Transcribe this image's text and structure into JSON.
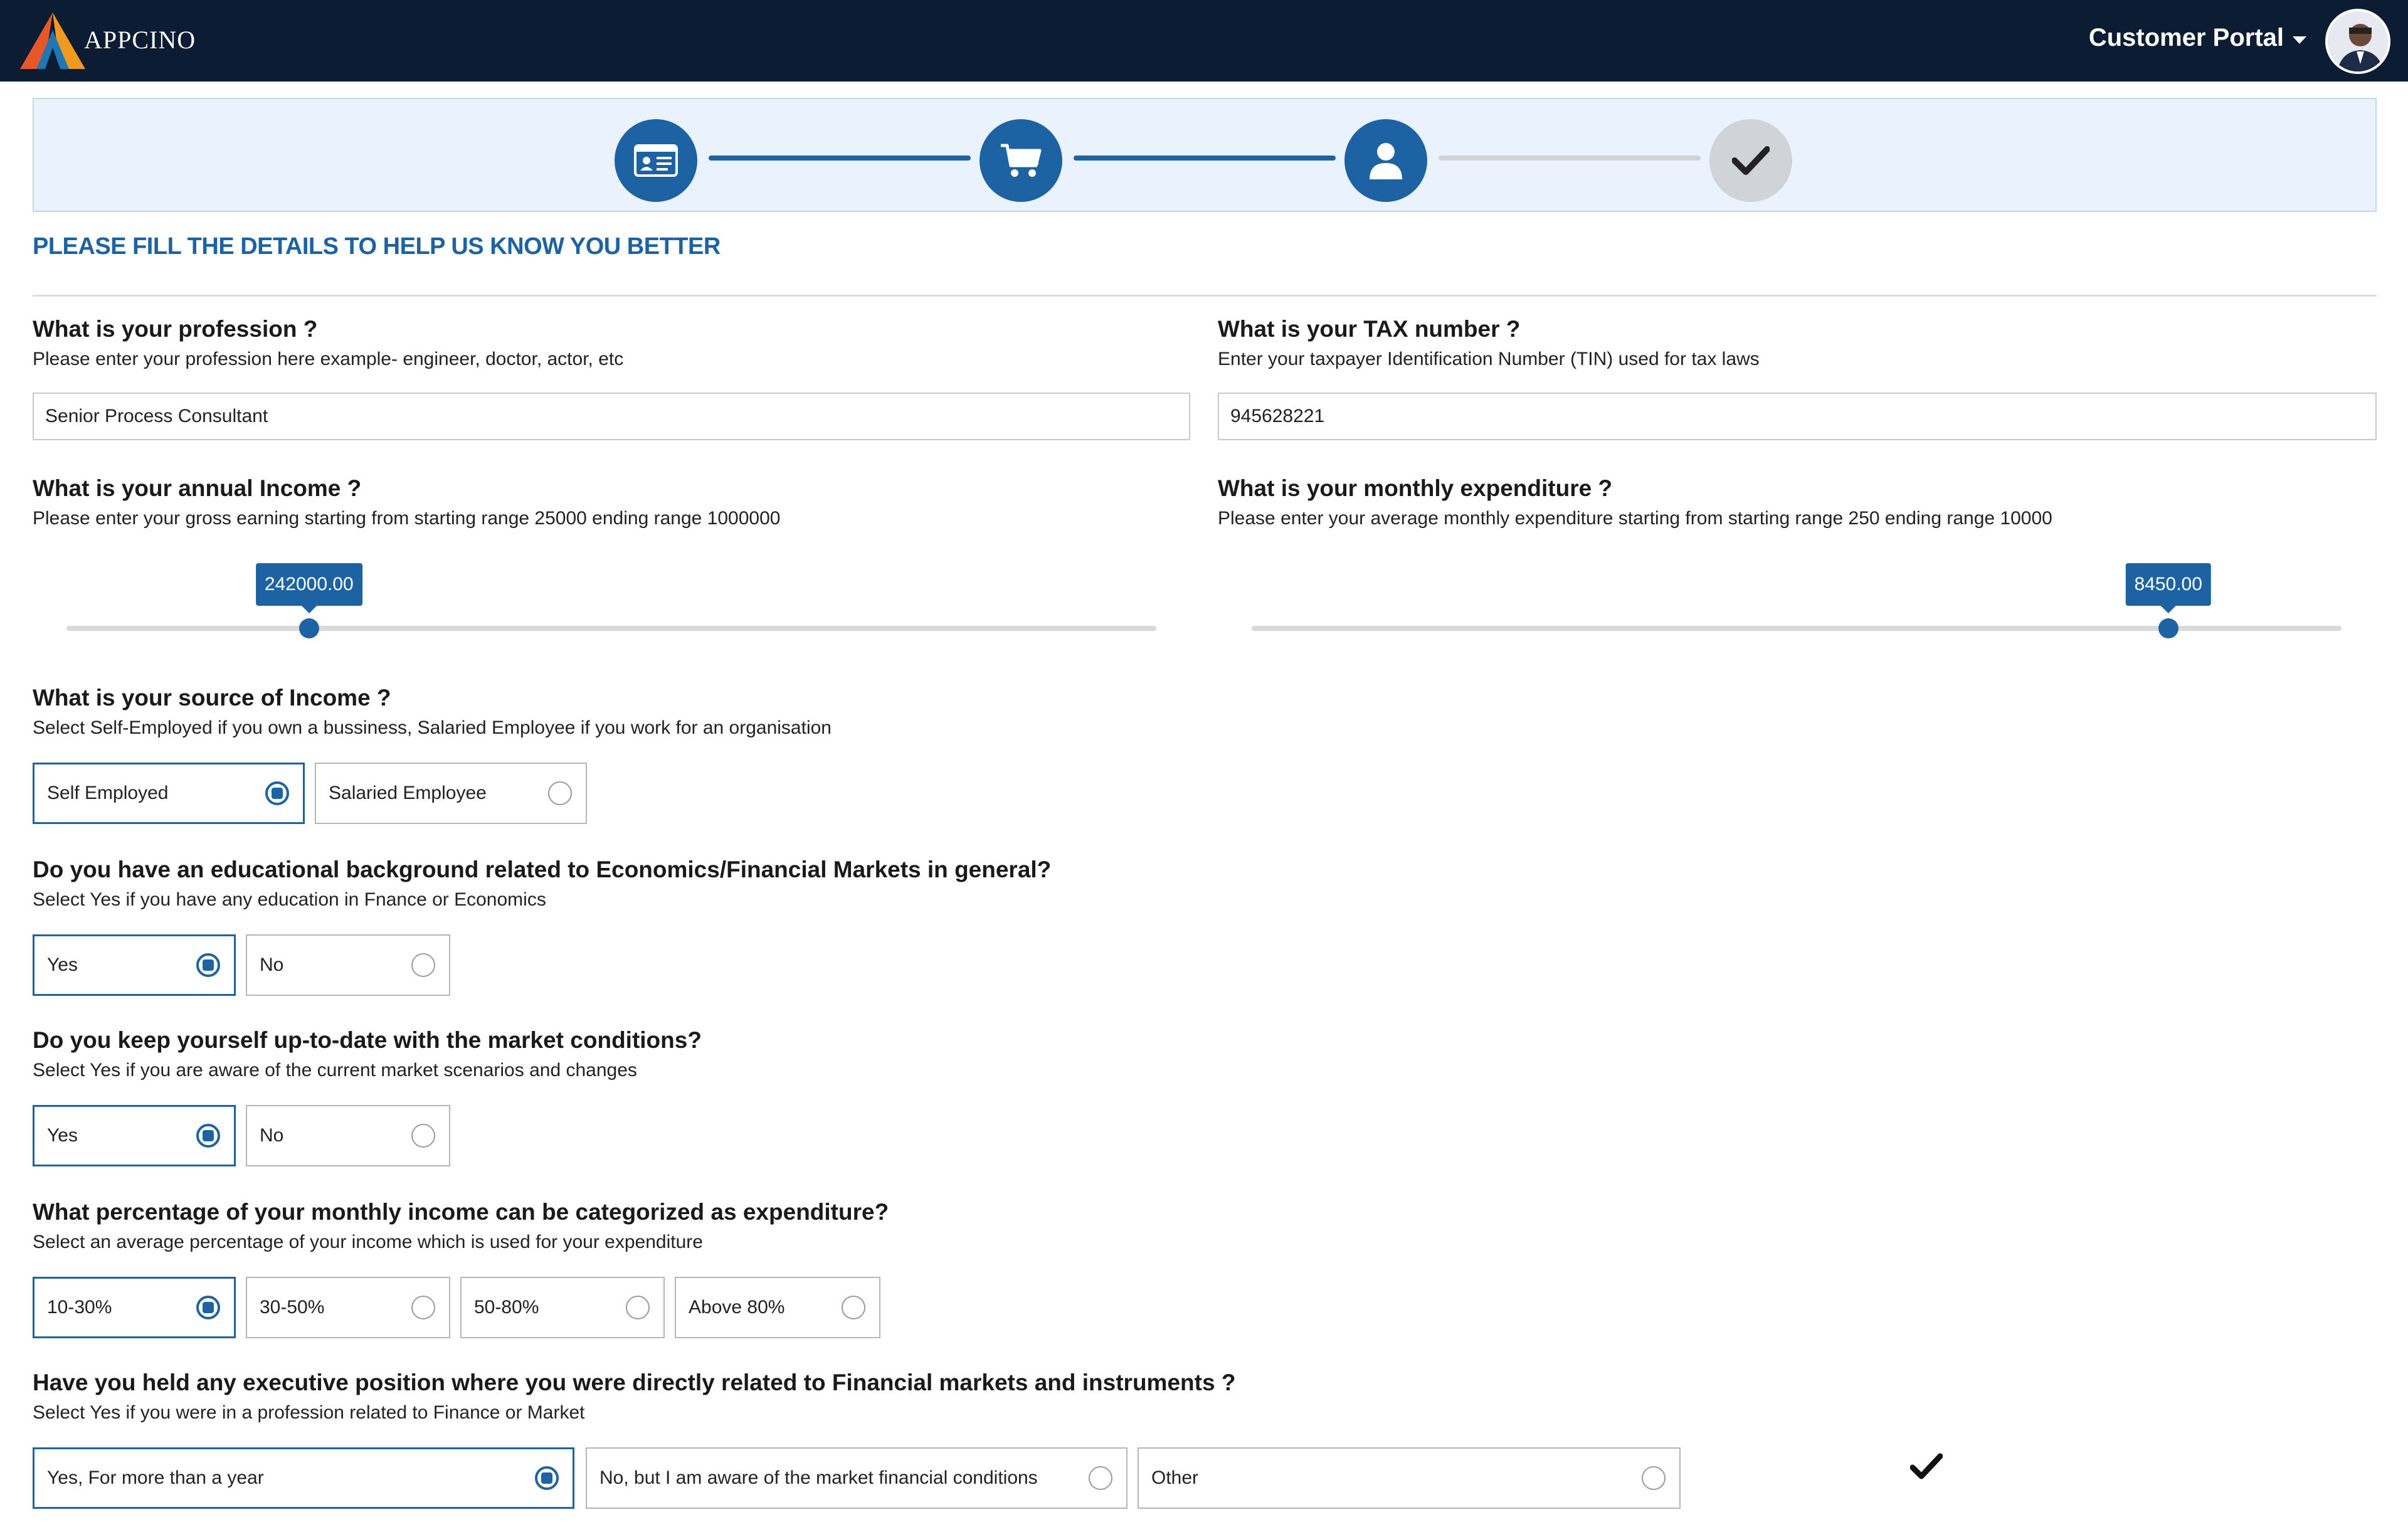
{
  "header": {
    "brand": "APPCINO",
    "portal_label": "Customer Portal",
    "icons": {
      "caret": "chevron-down-icon",
      "avatar": "user-avatar"
    }
  },
  "stepper": {
    "steps": [
      {
        "icon": "id-card-icon",
        "state": "done"
      },
      {
        "icon": "cart-icon",
        "state": "done"
      },
      {
        "icon": "user-icon",
        "state": "current"
      },
      {
        "icon": "check-icon",
        "state": "todo"
      }
    ],
    "colors": {
      "active": "#1d62a3",
      "inactive": "#d0d3d8",
      "background": "#eaf3fd"
    }
  },
  "form": {
    "heading": "PLEASE FILL THE DETAILS TO HELP US KNOW YOU BETTER",
    "profession": {
      "question": "What is your profession ?",
      "help": "Please enter your profession here example- engineer, doctor, actor, etc",
      "value": "Senior Process Consultant"
    },
    "tax": {
      "question": "What is your TAX number ?",
      "help": "Enter your taxpayer Identification Number (TIN) used for tax laws",
      "value": "945628221"
    },
    "annual_income": {
      "question": "What is your annual Income ?",
      "help": "Please enter your gross earning starting from  starting range 25000 ending range 1000000",
      "value_label": "242000.00",
      "value": 242000,
      "min": 25000,
      "max": 1000000
    },
    "monthly_expenditure": {
      "question": "What is your monthly expenditure ?",
      "help": "Please enter your average monthly expenditure starting from  starting range 250 ending range 10000",
      "value_label": "8450.00",
      "value": 8450,
      "min": 250,
      "max": 10000
    },
    "income_source": {
      "question": "What is your source of Income ?",
      "help": "Select Self-Employed if you own a bussiness, Salaried Employee if you work for an organisation",
      "options": [
        "Self Employed",
        "Salaried Employee"
      ],
      "selected": 0
    },
    "education": {
      "question": "Do you have an educational background related to Economics/Financial Markets in general?",
      "help": "Select Yes if you have any education in Fnance or Economics",
      "options": [
        "Yes",
        "No"
      ],
      "selected": 0
    },
    "market_update": {
      "question": "Do you keep yourself up-to-date with the market conditions?",
      "help": "Select Yes if you are aware of the current market scenarios and changes",
      "options": [
        "Yes",
        "No"
      ],
      "selected": 0
    },
    "expenditure_pct": {
      "question": "What percentage of your monthly income can be categorized as expenditure?",
      "help": "Select an average percentage of your income which is used for your expenditure",
      "options": [
        "10-30%",
        "30-50%",
        "50-80%",
        "Above 80%"
      ],
      "selected": 0
    },
    "executive": {
      "question": "Have you held any executive position where you were directly related to Financial markets and instruments ?",
      "help": "Select Yes if you were in a profession related to Finance or Market",
      "options": [
        "Yes, For more than a year",
        "No, but I am aware of the market financial conditions",
        "Other"
      ],
      "selected": 0
    },
    "complete_icon": "check-icon"
  }
}
